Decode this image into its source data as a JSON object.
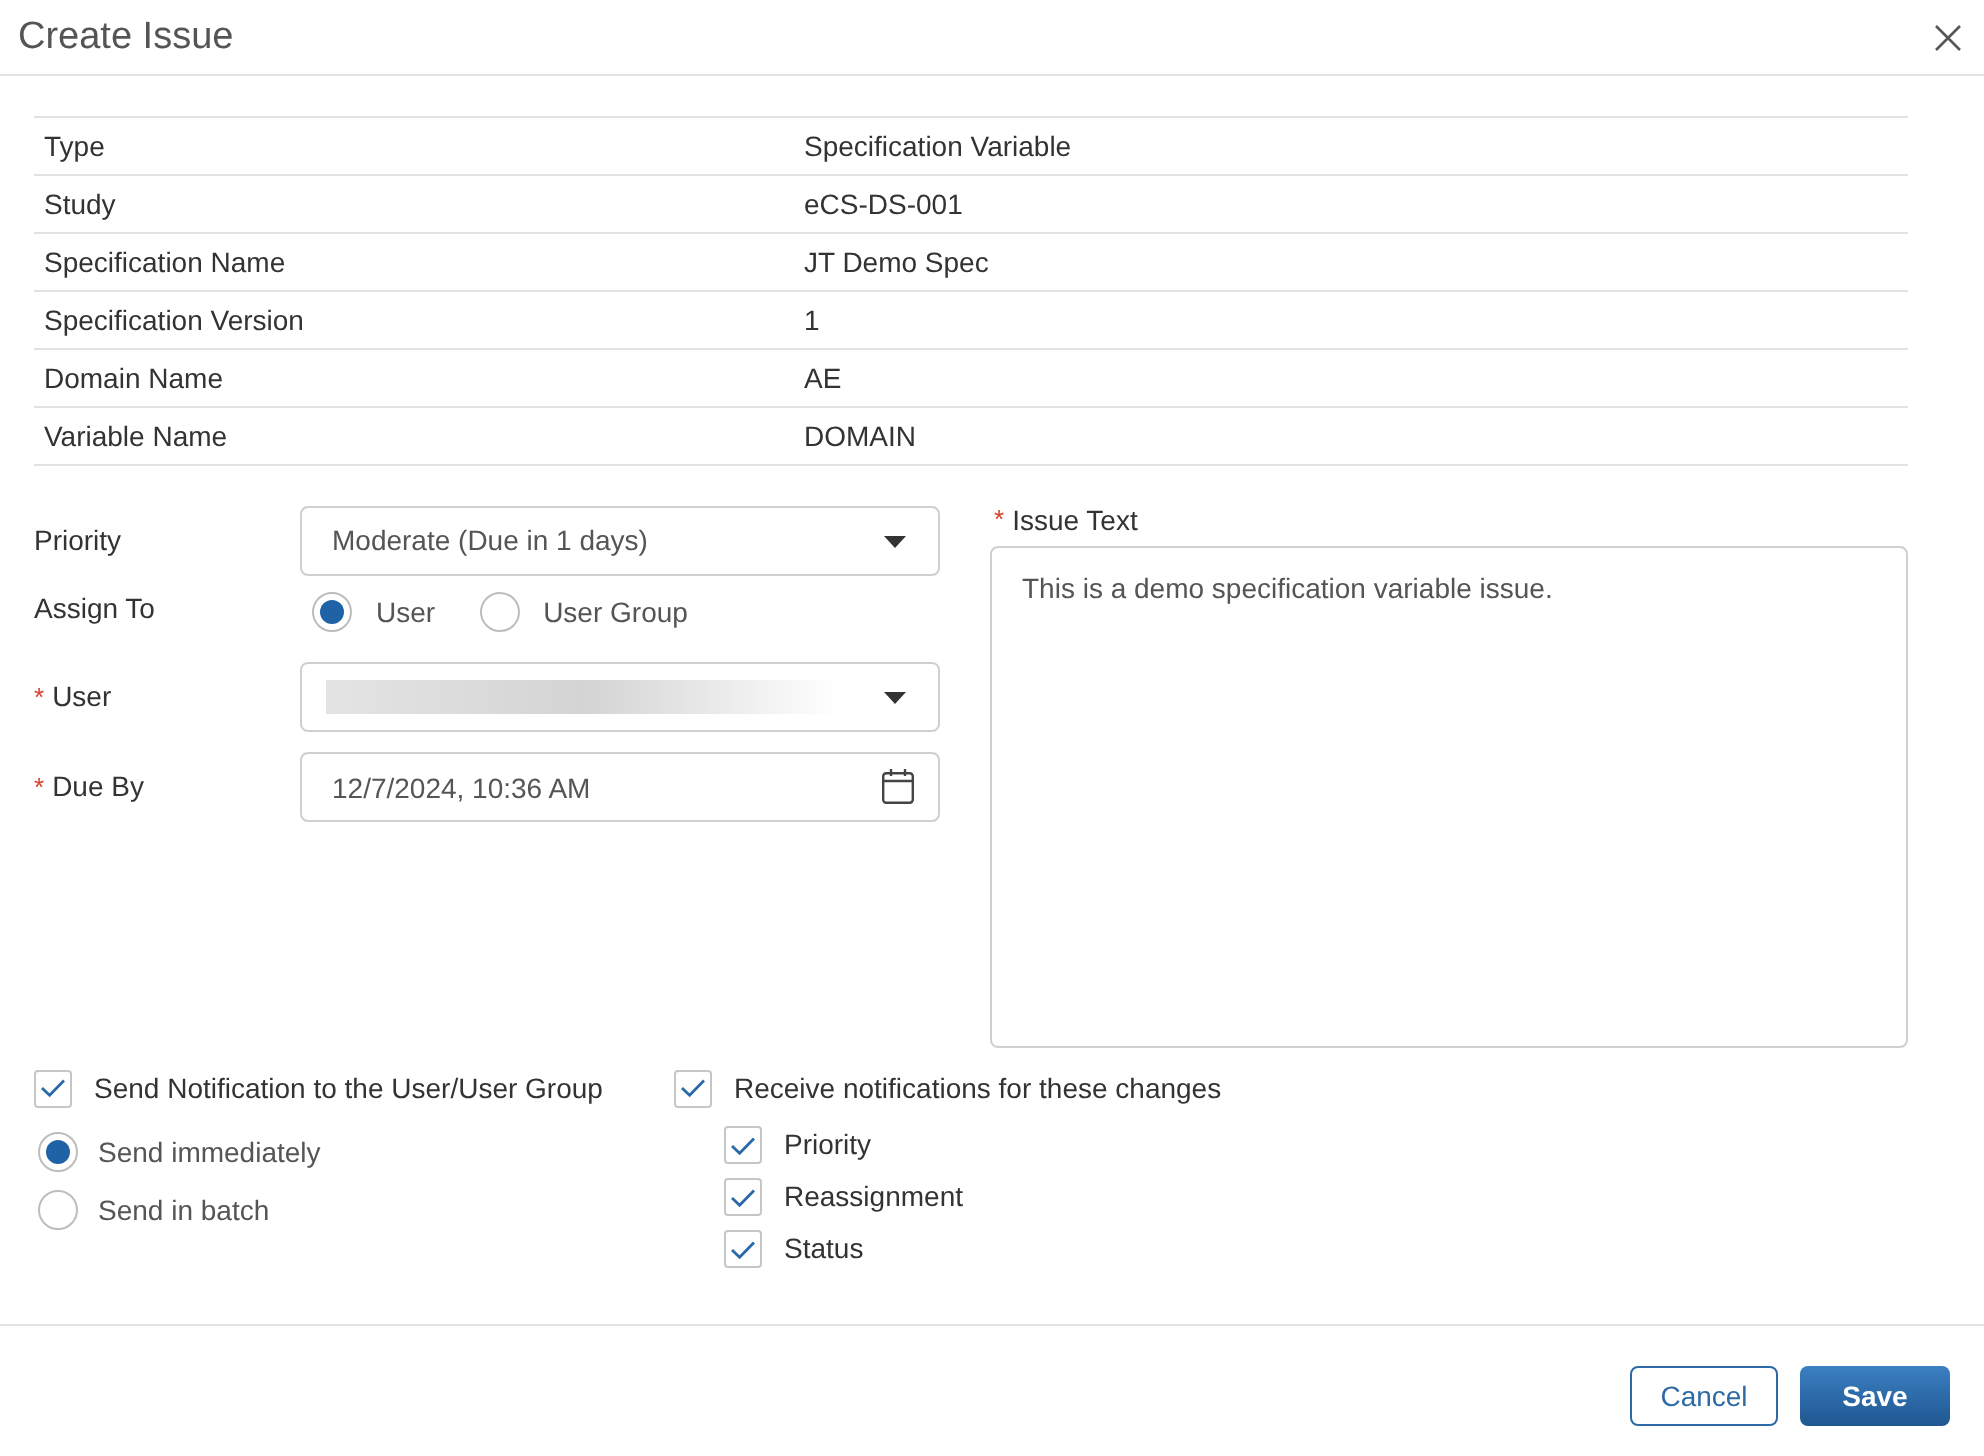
{
  "dialog": {
    "title": "Create Issue"
  },
  "details": [
    {
      "label": "Type",
      "value": "Specification Variable"
    },
    {
      "label": "Study",
      "value": "eCS-DS-001"
    },
    {
      "label": "Specification Name",
      "value": "JT Demo Spec"
    },
    {
      "label": "Specification Version",
      "value": "1"
    },
    {
      "label": "Domain Name",
      "value": "AE"
    },
    {
      "label": "Variable Name",
      "value": "DOMAIN"
    }
  ],
  "form": {
    "priority": {
      "label": "Priority",
      "value": "Moderate (Due in 1 days)"
    },
    "assign_to": {
      "label": "Assign To",
      "options": [
        {
          "label": "User",
          "selected": true
        },
        {
          "label": "User Group",
          "selected": false
        }
      ]
    },
    "user": {
      "label": "User",
      "marker": "*",
      "redacted": true
    },
    "due_by": {
      "label": "Due By",
      "marker": "*",
      "value": "12/7/2024, 10:36 AM"
    },
    "issue_text": {
      "label": "Issue Text",
      "marker": "*",
      "value": "This is a demo specification variable issue."
    }
  },
  "notifications": {
    "send": {
      "label": "Send Notification to the User/User Group",
      "checked": true,
      "options": [
        {
          "label": "Send immediately",
          "selected": true
        },
        {
          "label": "Send in batch",
          "selected": false
        }
      ]
    },
    "receive": {
      "label": "Receive notifications for these changes",
      "checked": true,
      "changes": [
        {
          "label": "Priority",
          "checked": true
        },
        {
          "label": "Reassignment",
          "checked": true
        },
        {
          "label": "Status",
          "checked": true
        }
      ]
    }
  },
  "buttons": [
    {
      "label": "Cancel",
      "kind": "secondary"
    },
    {
      "label": "Save",
      "kind": "primary"
    }
  ]
}
